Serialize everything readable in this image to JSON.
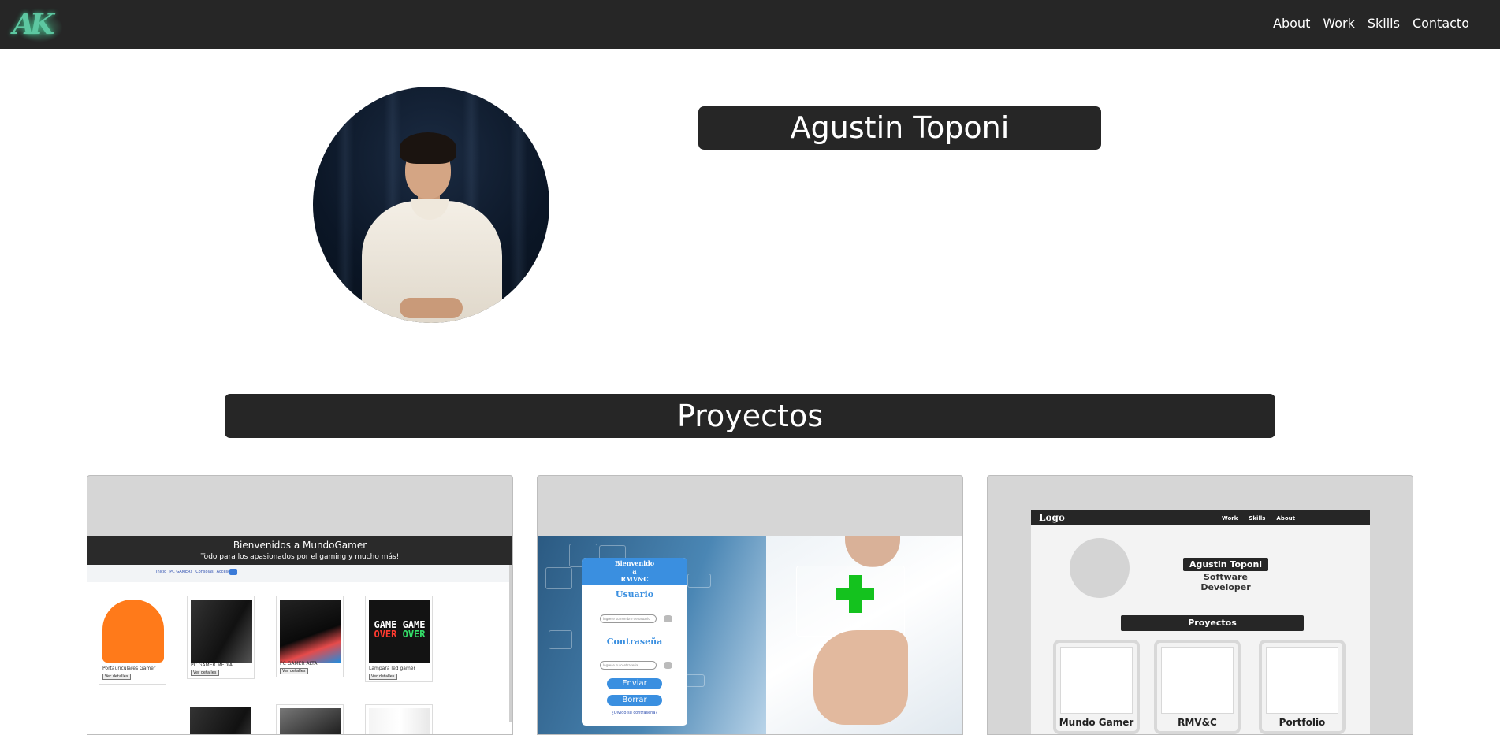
{
  "navbar": {
    "logo_text": "AK",
    "links": [
      "About",
      "Work",
      "Skills",
      "Contacto"
    ]
  },
  "hero": {
    "name": "Agustin Toponi"
  },
  "projects": {
    "title": "Proyectos",
    "cards": [
      {
        "id": "mundogamer",
        "title": "Bienvenidos a MundoGamer",
        "subtitle": "Todo para los apasionados por el gaming y mucho más!",
        "nav_links": [
          "Inicio",
          "PC GAMERs",
          "Consolas",
          "Accesorios"
        ],
        "products": [
          {
            "name": "Portauriculares Gamer",
            "button": "Ver detalles"
          },
          {
            "name": "PC GAMER MEDIA",
            "button": "Ver detalles"
          },
          {
            "name": "PC GAMER ALTA",
            "button": "Ver detalles"
          },
          {
            "name": "Lampara led gamer",
            "button": "Ver detalles"
          }
        ],
        "lamp_text": [
          "GAME",
          "OVER",
          "GAME",
          "OVER"
        ]
      },
      {
        "id": "rmvc",
        "header": [
          "Bienvenido",
          "a",
          "RMV&C"
        ],
        "user_label": "Usuario",
        "user_placeholder": "Ingrese su nombre de usuario",
        "pass_label": "Contraseña",
        "pass_placeholder": "Ingrese su contraseña",
        "send_button": "Enviar",
        "clear_button": "Borrar",
        "forgot_link": "¿Olvido su contraseña?"
      },
      {
        "id": "portfolio",
        "logo": "Logo",
        "nav_links": [
          "Work",
          "Skills",
          "About"
        ],
        "name": "Agustin Toponi",
        "subtitle": "Software Developer",
        "section": "Proyectos",
        "items": [
          "Mundo Gamer",
          "RMV&C",
          "Portfolio"
        ]
      }
    ]
  },
  "colors": {
    "navbar_bg": "#262626",
    "logo_green": "#5dc7a1",
    "accent_blue": "#3a8fe0",
    "medical_green": "#14c21e"
  }
}
